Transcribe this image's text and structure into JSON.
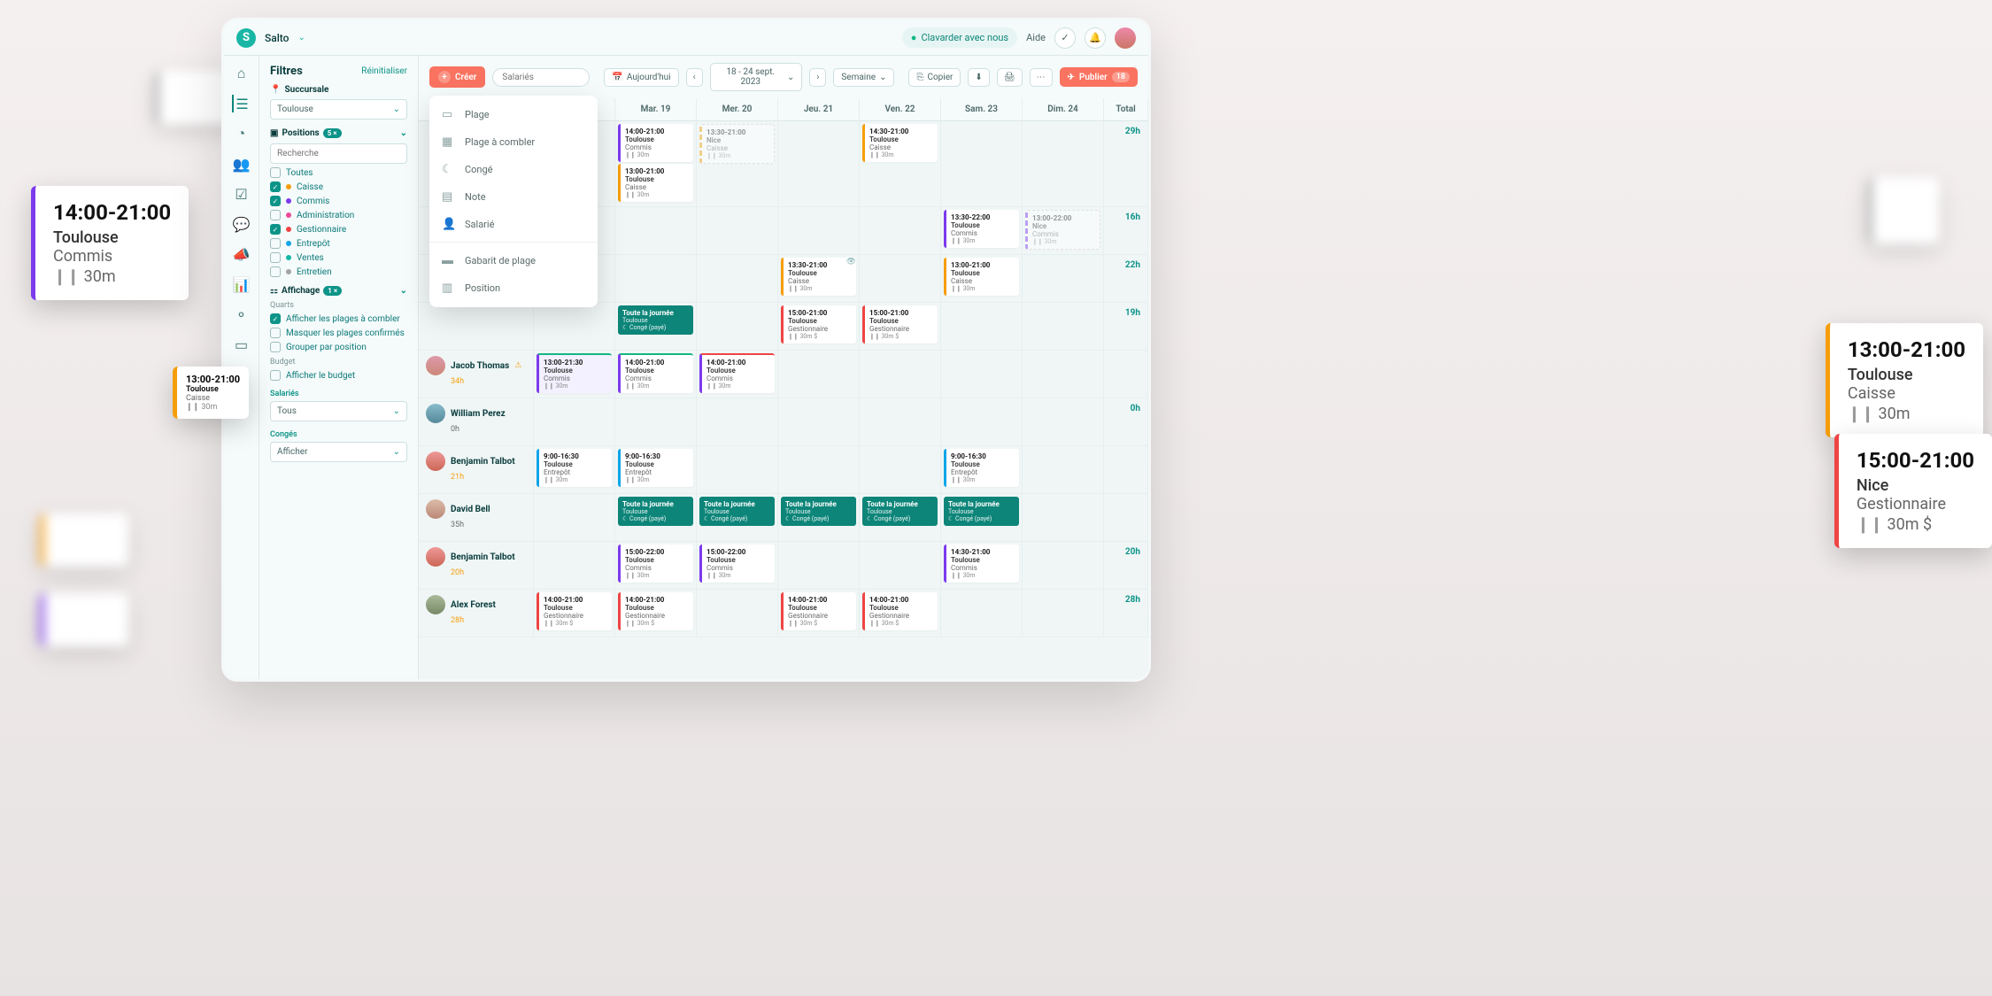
{
  "topbar": {
    "brand": "Salto",
    "chat": "Clavarder avec nous",
    "help": "Aide"
  },
  "filters": {
    "title": "Filtres",
    "reset": "Réinitialiser",
    "branch_label": "Succursale",
    "branch_value": "Toulouse",
    "positions_label": "Positions",
    "positions_count": "5 ×",
    "search_placeholder": "Recherche",
    "display_label": "Affichage",
    "display_count": "1 ×",
    "quarts": "Quarts",
    "opt_all": "Toutes",
    "opt_caisse": "Caisse",
    "opt_commis": "Commis",
    "opt_admin": "Administration",
    "opt_gest": "Gestionnaire",
    "opt_entrepot": "Entrepôt",
    "opt_ventes": "Ventes",
    "opt_entretien": "Entretien",
    "opt_fill": "Afficher les plages à combler",
    "opt_hide": "Masquer les plages confirmés",
    "opt_group": "Grouper par position",
    "budget": "Budget",
    "opt_budget": "Afficher le budget",
    "sal_label": "Salariés",
    "sal_value": "Tous",
    "leave_label": "Congés",
    "leave_value": "Afficher"
  },
  "toolbar": {
    "create": "Créer",
    "search": "Salariés",
    "today": "Aujourd'hui",
    "range": "18 - 24 sept. 2023",
    "view": "Semaine",
    "copy": "Copier",
    "publish": "Publier",
    "publish_count": "18"
  },
  "createMenu": {
    "plage": "Plage",
    "combler": "Plage à combler",
    "conge": "Congé",
    "note": "Note",
    "salarie": "Salarié",
    "gabarit": "Gabarit de plage",
    "position": "Position"
  },
  "days": {
    "d1": "Mar. 19",
    "d2": "Mer. 20",
    "d3": "Jeu. 21",
    "d4": "Ven. 22",
    "d5": "Sam. 23",
    "d6": "Dim. 24",
    "total": "Total"
  },
  "rows": {
    "r1": {
      "total": "29h",
      "d1a": {
        "tm": "14:00-21:00",
        "loc": "Toulouse",
        "pos": "Commis",
        "dur": "30m"
      },
      "d1b": {
        "tm": "13:00-21:00",
        "loc": "Toulouse",
        "pos": "Caisse",
        "dur": "30m"
      },
      "d2": {
        "tm": "13:30-21:00",
        "loc": "Nice",
        "pos": "Caisse",
        "dur": "30m"
      },
      "d4": {
        "tm": "14:30-21:00",
        "loc": "Toulouse",
        "pos": "Caisse",
        "dur": "30m"
      }
    },
    "r2": {
      "total": "16h",
      "d5": {
        "tm": "13:30-22:00",
        "loc": "Toulouse",
        "pos": "Commis",
        "dur": "30m"
      },
      "d6": {
        "tm": "13:00-22:00",
        "loc": "Nice",
        "pos": "Commis",
        "dur": "30m"
      }
    },
    "r3": {
      "total": "22h",
      "d3": {
        "tm": "13:30-21:00",
        "loc": "Toulouse",
        "pos": "Caisse",
        "dur": "30m"
      },
      "d5": {
        "tm": "13:00-21:00",
        "loc": "Toulouse",
        "pos": "Caisse",
        "dur": "30m"
      }
    },
    "r4": {
      "total": "19h",
      "d1": {
        "tm": "Toute la journée",
        "loc": "Toulouse",
        "lbl": "Congé (payé)"
      },
      "d3": {
        "tm": "15:00-21:00",
        "loc": "Toulouse",
        "pos": "Gestionnaire",
        "dur": "30m $"
      },
      "d4": {
        "tm": "15:00-21:00",
        "loc": "Toulouse",
        "pos": "Gestionnaire",
        "dur": "30m $"
      }
    },
    "jacob": {
      "name": "Jacob Thomas",
      "hours": "34h",
      "d0": {
        "tm": "13:00-21:30",
        "loc": "Toulouse",
        "pos": "Commis",
        "dur": "30m"
      },
      "d1": {
        "tm": "14:00-21:00",
        "loc": "Toulouse",
        "pos": "Commis",
        "dur": "30m"
      },
      "d2": {
        "tm": "14:00-21:00",
        "loc": "Toulouse",
        "pos": "Commis",
        "dur": "30m"
      }
    },
    "william": {
      "name": "William Perez",
      "hours": "0h",
      "total": "0h"
    },
    "benjamin1": {
      "name": "Benjamin Talbot",
      "hours": "21h",
      "d0": {
        "tm": "9:00-16:30",
        "loc": "Toulouse",
        "pos": "Entrepôt",
        "dur": "30m"
      },
      "d1": {
        "tm": "9:00-16:30",
        "loc": "Toulouse",
        "pos": "Entrepôt",
        "dur": "30m"
      },
      "d5": {
        "tm": "9:00-16:30",
        "loc": "Toulouse",
        "pos": "Entrepôt",
        "dur": "30m"
      }
    },
    "david": {
      "name": "David Bell",
      "hours": "35h",
      "lv": {
        "tm": "Toute la journée",
        "loc": "Toulouse",
        "lbl": "Congé (payé)"
      }
    },
    "benjamin2": {
      "name": "Benjamin Talbot",
      "hours": "20h",
      "total": "20h",
      "d1": {
        "tm": "15:00-22:00",
        "loc": "Toulouse",
        "pos": "Commis",
        "dur": "30m"
      },
      "d2": {
        "tm": "15:00-22:00",
        "loc": "Toulouse",
        "pos": "Commis",
        "dur": "30m"
      },
      "d5": {
        "tm": "14:30-21:00",
        "loc": "Toulouse",
        "pos": "Commis",
        "dur": "30m"
      }
    },
    "alex": {
      "name": "Alex Forest",
      "hours": "28h",
      "total": "28h",
      "sh": {
        "tm": "14:00-21:00",
        "loc": "Toulouse",
        "pos": "Gestionnaire",
        "dur": "30m $"
      }
    }
  },
  "callouts": {
    "c1": {
      "tm": "14:00-21:00",
      "loc": "Toulouse",
      "pos": "Commis",
      "dur": "30m"
    },
    "c2": {
      "tm": "13:00-21:00",
      "loc": "Toulouse",
      "pos": "Caisse",
      "dur": "30m"
    },
    "c3": {
      "tm": "13:00-21:00",
      "loc": "Toulouse",
      "pos": "Caisse",
      "dur": "30m"
    },
    "c4": {
      "tm": "15:00-21:00",
      "loc": "Nice",
      "pos": "Gestionnaire",
      "dur": "30m $"
    }
  },
  "colors": {
    "commis": "#7c3aed",
    "caisse": "#f59e0b",
    "gest": "#ef4444",
    "entrepot": "#0ea5e9",
    "nice": "#9ca3af"
  }
}
